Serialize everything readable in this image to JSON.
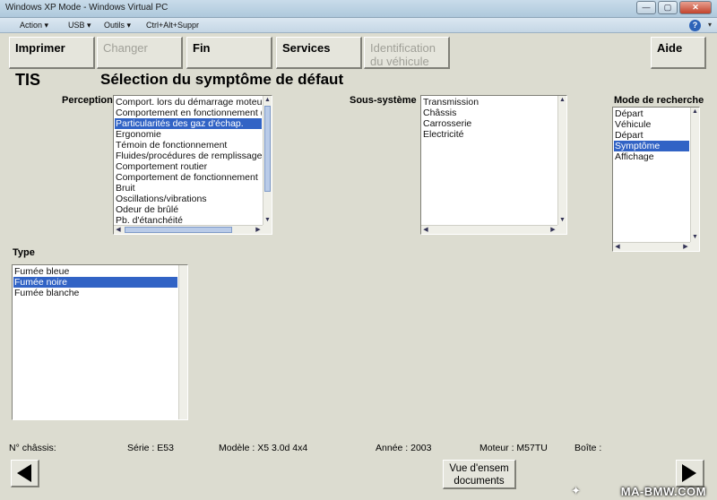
{
  "window": {
    "title": "Windows XP Mode - Windows Virtual PC",
    "controls": [
      "minimize-icon",
      "maximize-icon",
      "close-icon"
    ]
  },
  "menubar": {
    "action": "Action",
    "usb": "USB",
    "outils": "Outils",
    "ctrl_alt_suppr": "Ctrl+Alt+Suppr",
    "help_icon": "?"
  },
  "toolbar": {
    "imprimer": "Imprimer",
    "changer": "Changer",
    "fin": "Fin",
    "services": "Services",
    "identification_line1": "Identification",
    "identification_line2": "du véhicule",
    "aide": "Aide"
  },
  "header": {
    "app": "TIS",
    "title": "Sélection du symptôme de défaut"
  },
  "perception": {
    "label": "Perception",
    "items": [
      "Comport. lors du démarrage moteur",
      "Comportement en fonctionnement (",
      "Particularités des gaz d'échap.",
      "Ergonomie",
      "Témoin de fonctionnement",
      "Fluides/procédures de remplissage",
      "Comportement routier",
      "Comportement de fonctionnement",
      "Bruit",
      "Oscillations/vibrations",
      "Odeur de brûlé",
      "Pb. d'étanchéité"
    ],
    "selected_index": 2
  },
  "sous_systeme": {
    "label": "Sous-système",
    "items": [
      "Transmission",
      "Châssis",
      "Carrosserie",
      "Electricité"
    ]
  },
  "mode_recherche": {
    "label": "Mode de recherche",
    "items": [
      "Départ",
      "Véhicule",
      "Départ",
      "Symptôme",
      "Affichage"
    ],
    "selected_index": 3
  },
  "type": {
    "label": "Type",
    "items": [
      "Fumée bleue",
      "Fumée noire",
      "Fumée blanche"
    ],
    "selected_index": 1
  },
  "status": {
    "chassis": "N° châssis:",
    "serie": "Série : E53",
    "modele": "Modèle : X5 3.0d 4x4",
    "annee": "Année : 2003",
    "moteur": "Moteur : M57TU",
    "boite": "Boîte :"
  },
  "footer": {
    "doc_line1": "Vue d'ensem",
    "doc_line2": "documents",
    "prev_icon": "arrow-left-icon",
    "next_icon": "arrow-right-icon"
  },
  "watermark": "MA-BMW.COM",
  "colors": {
    "selection": "#3163c5",
    "background": "#dcdcd0"
  }
}
